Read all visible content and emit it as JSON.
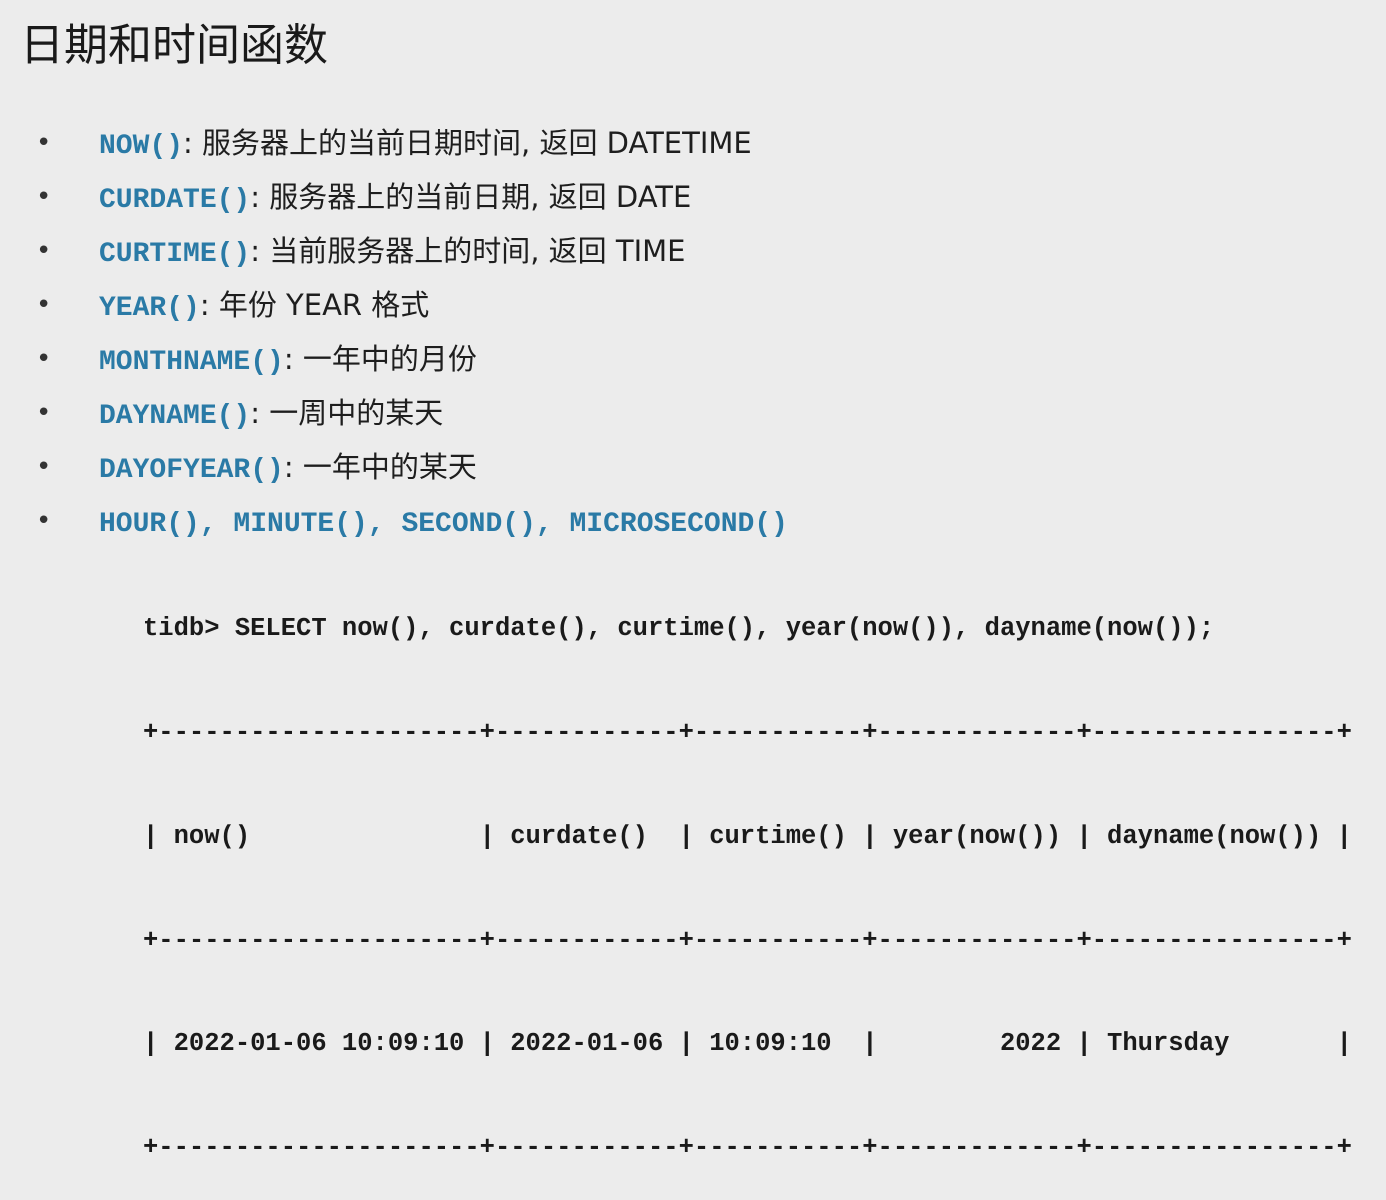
{
  "title": "日期和时间函数",
  "bullets": [
    {
      "fn": "NOW()",
      "desc": ": 服务器上的当前日期时间, 返回 DATETIME"
    },
    {
      "fn": "CURDATE()",
      "desc": ": 服务器上的当前日期, 返回 DATE"
    },
    {
      "fn": "CURTIME()",
      "desc": ": 当前服务器上的时间, 返回 TIME"
    },
    {
      "fn": "YEAR()",
      "desc": ": 年份 YEAR 格式"
    },
    {
      "fn": "MONTHNAME()",
      "desc": ": 一年中的月份"
    },
    {
      "fn": "DAYNAME()",
      "desc": ": 一周中的某天"
    },
    {
      "fn": "DAYOFYEAR()",
      "desc": ": 一年中的某天"
    },
    {
      "fn": "HOUR(), MINUTE(), SECOND(), MICROSECOND()",
      "desc": ""
    }
  ],
  "code": {
    "query": "tidb> SELECT now(), curdate(), curtime(), year(now()), dayname(now());",
    "border": "+---------------------+------------+-----------+-------------+----------------+",
    "header": "| now()               | curdate()  | curtime() | year(now()) | dayname(now()) |",
    "row": "| 2022-01-06 10:09:10 | 2022-01-06 | 10:09:10  |        2022 | Thursday       |",
    "columns": [
      "now()",
      "curdate()",
      "curtime()",
      "year(now())",
      "dayname(now())"
    ],
    "values": [
      "2022-01-06 10:09:10",
      "2022-01-06",
      "10:09:10",
      "2022",
      "Thursday"
    ]
  }
}
